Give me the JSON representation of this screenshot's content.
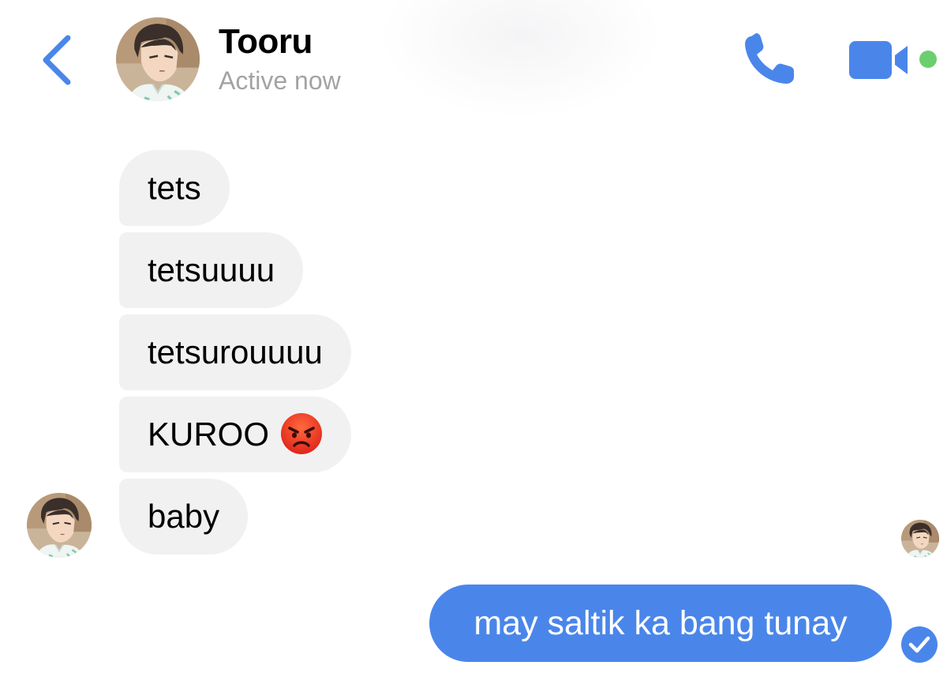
{
  "header": {
    "contact_name": "Tooru",
    "status": "Active now",
    "back_icon": "chevron-left-icon",
    "call_icon": "phone-icon",
    "video_icon": "video-camera-icon",
    "accent_color": "#4a86ea",
    "online_color": "#6ccf6e"
  },
  "messages": {
    "incoming": [
      {
        "text": "tets"
      },
      {
        "text": "tetsuuuu"
      },
      {
        "text": "tetsurouuuu"
      },
      {
        "text": "KUROO",
        "emoji": "angry-face-icon"
      },
      {
        "text": "baby"
      }
    ],
    "outgoing": [
      {
        "text": "may saltik ka bang tunay",
        "status_icon": "delivered-check-icon"
      }
    ]
  },
  "colors": {
    "incoming_bubble": "#f1f1f1",
    "outgoing_bubble": "#4a86ea",
    "status_text": "#a3a3a3"
  }
}
